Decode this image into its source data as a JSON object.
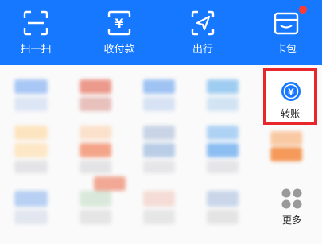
{
  "top_actions": [
    {
      "label": "扫一扫",
      "icon": "scan-icon"
    },
    {
      "label": "收付款",
      "icon": "pay-receive-icon"
    },
    {
      "label": "出行",
      "icon": "travel-icon"
    },
    {
      "label": "卡包",
      "icon": "card-wallet-icon"
    }
  ],
  "grid": {
    "highlighted": {
      "label": "转账",
      "icon": "transfer-yuan-icon"
    },
    "more": {
      "label": "更多",
      "icon": "more-grid-icon"
    }
  },
  "colors": {
    "brand_blue": "#1677ff",
    "highlight_border": "#e8262b",
    "badge_red": "#ff3b30"
  }
}
